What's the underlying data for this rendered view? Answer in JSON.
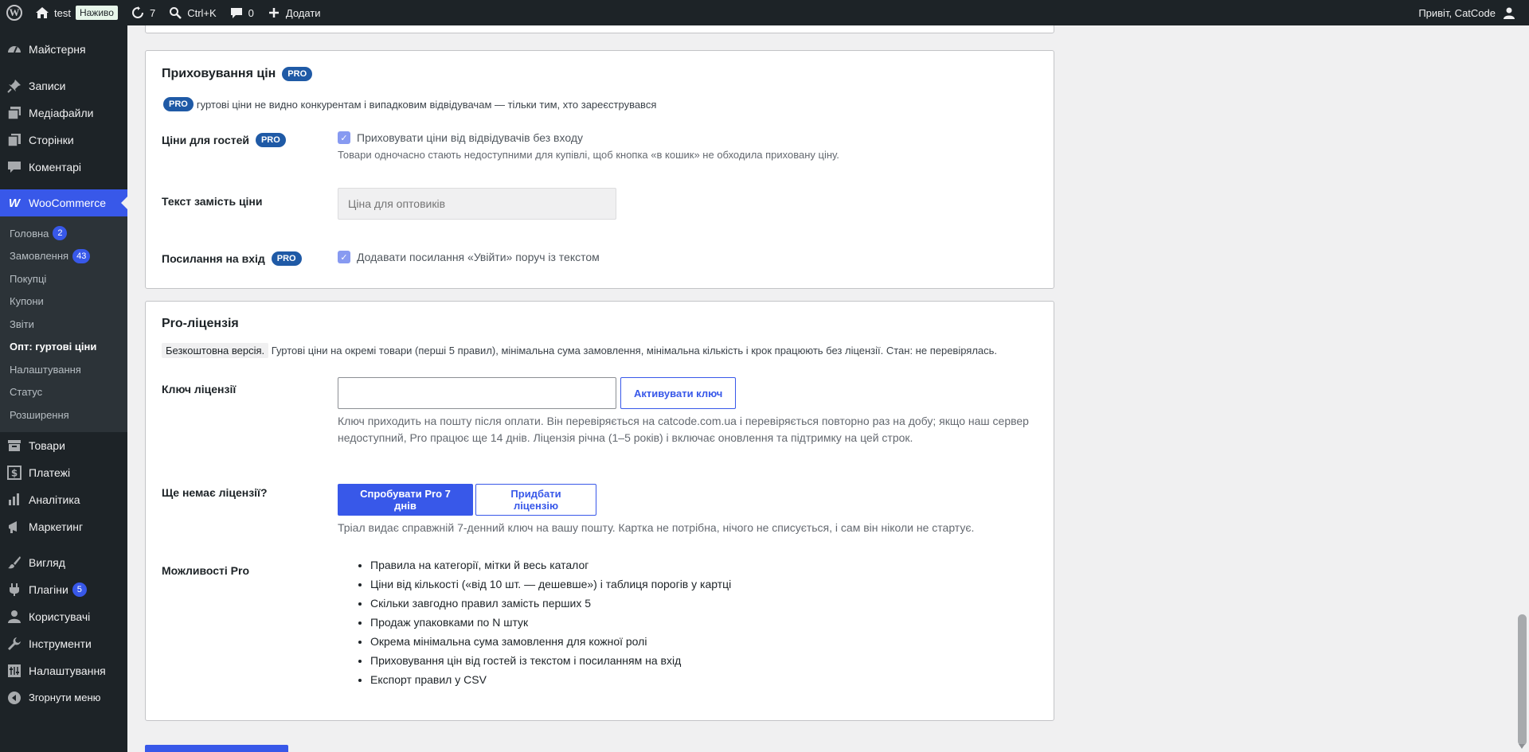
{
  "adminbar": {
    "site_name": "test",
    "live_label": "Наживо",
    "updates_count": "7",
    "search_shortcut": "Ctrl+K",
    "comments_count": "0",
    "new_label": "Додати",
    "greeting": "Привіт, CatCode"
  },
  "sidebar": {
    "dashboard": "Майстерня",
    "posts": "Записи",
    "media": "Медіафайли",
    "pages": "Сторінки",
    "comments": "Коментарі",
    "woocommerce": "WooCommerce",
    "woo_sub": {
      "home": "Головна",
      "home_count": "2",
      "orders": "Замовлення",
      "orders_count": "43",
      "customers": "Покупці",
      "coupons": "Купони",
      "reports": "Звіти",
      "wholesale": "Опт: гуртові ціни",
      "settings": "Налаштування",
      "status": "Статус",
      "extensions": "Розширення"
    },
    "products": "Товари",
    "payments": "Платежі",
    "analytics": "Аналітика",
    "marketing": "Маркетинг",
    "appearance": "Вигляд",
    "plugins": "Плагіни",
    "plugins_count": "5",
    "users": "Користувачі",
    "tools": "Інструменти",
    "settings": "Налаштування",
    "collapse": "Згорнути меню"
  },
  "hide_prices": {
    "title": "Приховування цін",
    "pro_badge": "PRO",
    "intro": "гуртові ціни не видно конкурентам і випадковим відвідувачам — тільки тим, хто зареєструвався",
    "guest_prices_label": "Ціни для гостей",
    "guest_prices_checkbox": "Приховувати ціни від відвідувачів без входу",
    "guest_prices_desc": "Товари одночасно стають недоступними для купівлі, щоб кнопка «в кошик» не обходила приховану ціну.",
    "replace_text_label": "Текст замість ціни",
    "replace_text_placeholder": "Ціна для оптовиків",
    "login_link_label": "Посилання на вхід",
    "login_link_checkbox": "Додавати посилання «Увійти» поруч із текстом"
  },
  "license": {
    "title": "Pro-ліцензія",
    "free_badge": "Безкоштовна версія.",
    "free_desc": "Гуртові ціни на окремі товари (перші 5 правил), мінімальна сума замовлення, мінімальна кількість і крок працюють без ліцензії. Стан: не перевірялась.",
    "key_label": "Ключ ліцензії",
    "key_value": "",
    "activate_button": "Активувати ключ",
    "key_desc": "Ключ приходить на пошту після оплати. Він перевіряється на catcode.com.ua і перевіряється повторно раз на добу; якщо наш сервер недоступний, Pro працює ще 14 днів. Ліцензія річна (1–5 років) і включає оновлення та підтримку на цей строк.",
    "no_license_label": "Ще немає ліцензії?",
    "trial_button": "Спробувати Pro 7 днів",
    "buy_button": "Придбати ліцензію",
    "trial_desc": "Тріал видає справжній 7-денний ключ на вашу пошту. Картка не потрібна, нічого не списується, і сам він ніколи не стартує.",
    "features_label": "Можливості Pro",
    "features": [
      "Правила на категорії, мітки й весь каталог",
      "Ціни від кількості («від 10 шт. — дешевше») і таблиця порогів у картці",
      "Скільки завгодно правил замість перших 5",
      "Продаж упаковками по N штук",
      "Окрема мінімальна сума замовлення для кожної ролі",
      "Приховування цін від гостей із текстом і посиланням на вхід",
      "Експорт правил у CSV"
    ]
  },
  "colors": {
    "accent": "#3858e9",
    "adminbar_bg": "#1d2327",
    "pro_badge": "#1f5aa6"
  }
}
